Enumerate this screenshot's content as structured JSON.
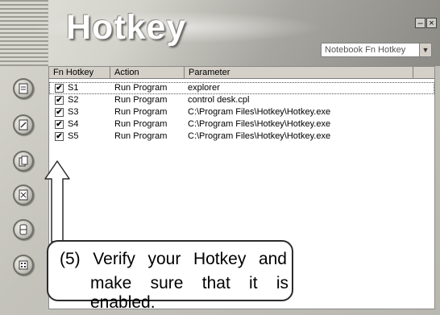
{
  "window": {
    "title": "Hotkey",
    "minimize_symbol": "–",
    "close_symbol": "×",
    "profile_select": {
      "value": "Notebook Fn Hotkey",
      "arrow_icon": "chevron-down-icon"
    }
  },
  "sidebar": {
    "buttons": [
      {
        "icon": "document-list-icon"
      },
      {
        "icon": "document-edit-icon"
      },
      {
        "icon": "documents-copy-icon"
      },
      {
        "icon": "document-delete-icon"
      },
      {
        "icon": "document-mirror-icon"
      },
      {
        "icon": "grid-settings-icon"
      }
    ]
  },
  "table": {
    "columns": [
      "Fn Hotkey",
      "Action",
      "Parameter"
    ],
    "rows": [
      {
        "enabled": true,
        "key": "S1",
        "action": "Run Program",
        "parameter": "explorer"
      },
      {
        "enabled": true,
        "key": "S2",
        "action": "Run Program",
        "parameter": "control desk.cpl"
      },
      {
        "enabled": true,
        "key": "S3",
        "action": "Run Program",
        "parameter": "C:\\Program Files\\Hotkey\\Hotkey.exe"
      },
      {
        "enabled": true,
        "key": "S4",
        "action": "Run Program",
        "parameter": "C:\\Program Files\\Hotkey\\Hotkey.exe"
      },
      {
        "enabled": true,
        "key": "S5",
        "action": "Run Program",
        "parameter": "C:\\Program Files\\Hotkey\\Hotkey.exe"
      }
    ],
    "check_mark": "✔"
  },
  "callout": {
    "line1": "(5) Verify your Hotkey and",
    "line2": "make sure that it is enabled."
  }
}
